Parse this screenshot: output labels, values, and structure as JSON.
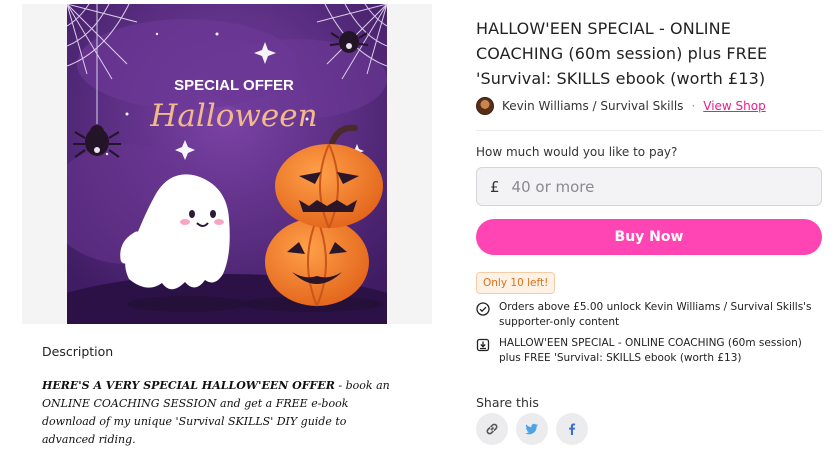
{
  "media": {
    "banner_line1": "SPECIAL OFFER",
    "banner_line2": "Halloween",
    "colors": {
      "background": "#5a2a82",
      "pumpkin": "#f07a1f",
      "accent": "#f2b98a"
    }
  },
  "description": {
    "heading": "Description",
    "body_bold": "HERE'S A VERY SPECIAL HALLOW'EEN OFFER",
    "body_rest": " - book an ONLINE COACHING SESSION and get a FREE e-book download of my unique 'Survival SKILLS' DIY guide to advanced riding."
  },
  "product": {
    "title": "HALLOW'EEN SPECIAL - ONLINE COACHING (60m session) plus FREE 'Survival: SKILLS ebook (worth £13)",
    "creator": "Kevin Williams / Survival Skills",
    "separator": "·",
    "view_shop": "View Shop",
    "accent_color": "#e91e8c"
  },
  "purchase": {
    "pay_label": "How much would you like to pay?",
    "currency": "£",
    "amount_placeholder": "40 or more",
    "buy_label": "Buy Now",
    "button_color": "#ff45b4"
  },
  "stock": {
    "badge": "Only 10 left!"
  },
  "features": [
    {
      "icon": "check-circle-icon",
      "text": "Orders above £5.00 unlock Kevin Williams / Survival Skills's supporter-only content"
    },
    {
      "icon": "download-box-icon",
      "text": "HALLOW'EEN SPECIAL - ONLINE COACHING (60m session) plus FREE 'Survival: SKILLS ebook (worth £13)"
    }
  ],
  "share": {
    "label": "Share this",
    "buttons": [
      "link-icon",
      "twitter-icon",
      "facebook-icon"
    ]
  }
}
